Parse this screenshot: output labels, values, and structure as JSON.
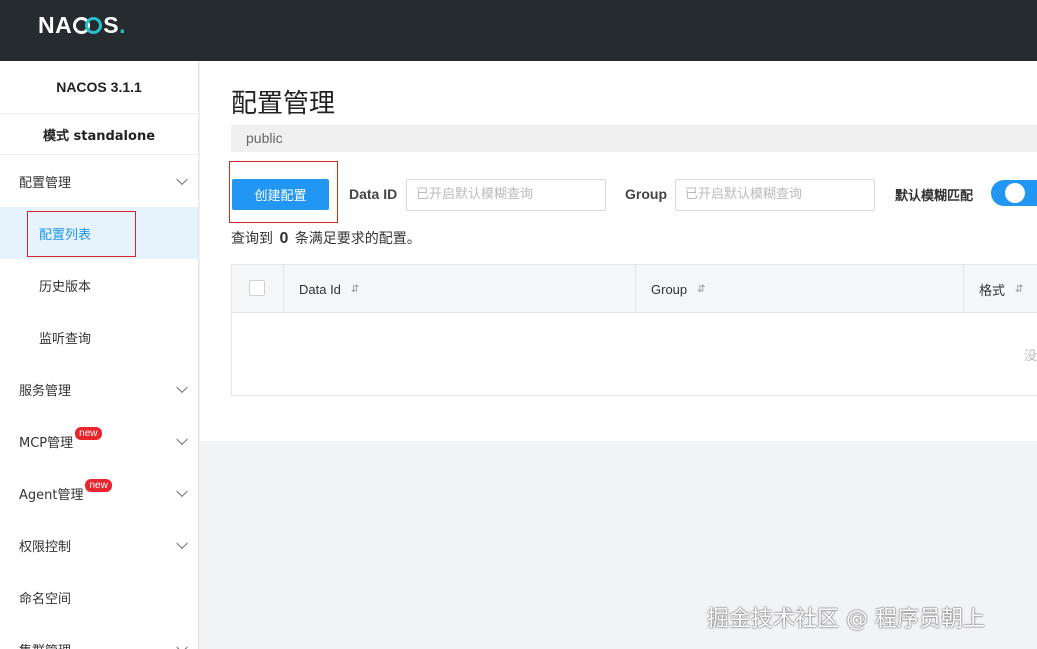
{
  "header": {
    "logo": "NACOS"
  },
  "sidebar": {
    "version": "NACOS 3.1.1",
    "mode": "模式 standalone",
    "config_menu": "配置管理",
    "config_sub": [
      "配置列表",
      "历史版本",
      "监听查询"
    ],
    "service_menu": "服务管理",
    "mcp_menu": "MCP管理",
    "agent_menu": "Agent管理",
    "new_badge": "new",
    "auth_menu": "权限控制",
    "namespace_menu": "命名空间",
    "cluster_menu": "集群管理"
  },
  "main": {
    "title": "配置管理",
    "namespace": "public",
    "create_button": "创建配置",
    "dataid_label": "Data ID",
    "dataid_placeholder": "已开启默认模糊查询",
    "group_label": "Group",
    "group_placeholder": "已开启默认模糊查询",
    "fuzzy_label": "默认模糊匹配",
    "fuzzy_enabled": true,
    "result_prefix": "查询到",
    "result_count": "0",
    "result_suffix": "条满足要求的配置。",
    "columns": [
      "Data Id",
      "Group",
      "格式"
    ],
    "sort_icon": "⇵",
    "empty_text": "没"
  },
  "watermark": "掘金技术社区 @ 程序员朝上",
  "colors": {
    "accent": "#2196f3",
    "highlight": "#d9262c",
    "header": "#262b30"
  }
}
